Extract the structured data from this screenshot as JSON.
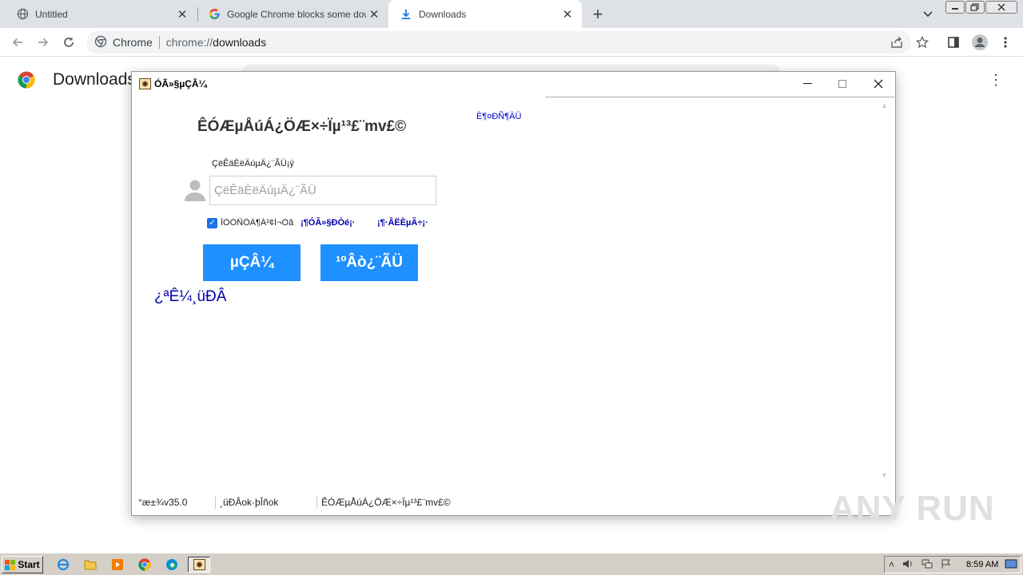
{
  "browser": {
    "tabs": [
      {
        "title": "Untitled",
        "icon": "globe-icon"
      },
      {
        "title": "Google Chrome blocks some downloa",
        "icon": "google-icon"
      },
      {
        "title": "Downloads",
        "icon": "download-icon"
      }
    ],
    "active_tab": 2,
    "omnibox": {
      "chip": "Chrome",
      "url_scheme": "chrome://",
      "url_rest": "downloads"
    }
  },
  "page": {
    "title": "Downloads"
  },
  "dialog": {
    "title": "ÓÃ»§µÇÂ¼",
    "heading": "ÊÓÆµÅúÁ¿ÖÆ×÷Ïµ¹³£¨mv£©",
    "top_link": "È¶¤ÐÑ¶ÄÜ",
    "field_label": "ÇëÊäÈëÄúµÄ¿¨ÃÜ¡ý",
    "input_placeholder": "ÇëÊäÈëÄúµÄ¿¨ÃÜ",
    "remember_label": "ÎÒÒÑÔÄ¶Á²¢Í¬Òâ",
    "remember_checked": true,
    "link_agreement": "¡¶ÓÃ»§Ð­Òé¡·",
    "link_privacy": "¡¶·ÂËÈµÃ÷¡·",
    "btn_login": "µÇÂ¼",
    "btn_buy": "¹ºÂò¿¨ÃÜ",
    "register_link": "¿ªÊ¼¸üÐÂ",
    "status": {
      "version": "°æ±¾v35.0",
      "update": "¸üÐÂok·þÎñok",
      "product": "ÊÓÆµÅúÁ¿ÖÆ×÷Ïµ¹³£¨mv£©"
    }
  },
  "watermark": "ANY RUN",
  "taskbar": {
    "start_label": "Start",
    "clock": "8:59 AM"
  },
  "colors": {
    "accent_button": "#1e90ff",
    "link": "#0000aa",
    "tab_strip": "#dee1e6",
    "taskbar": "#d4d0c8"
  }
}
